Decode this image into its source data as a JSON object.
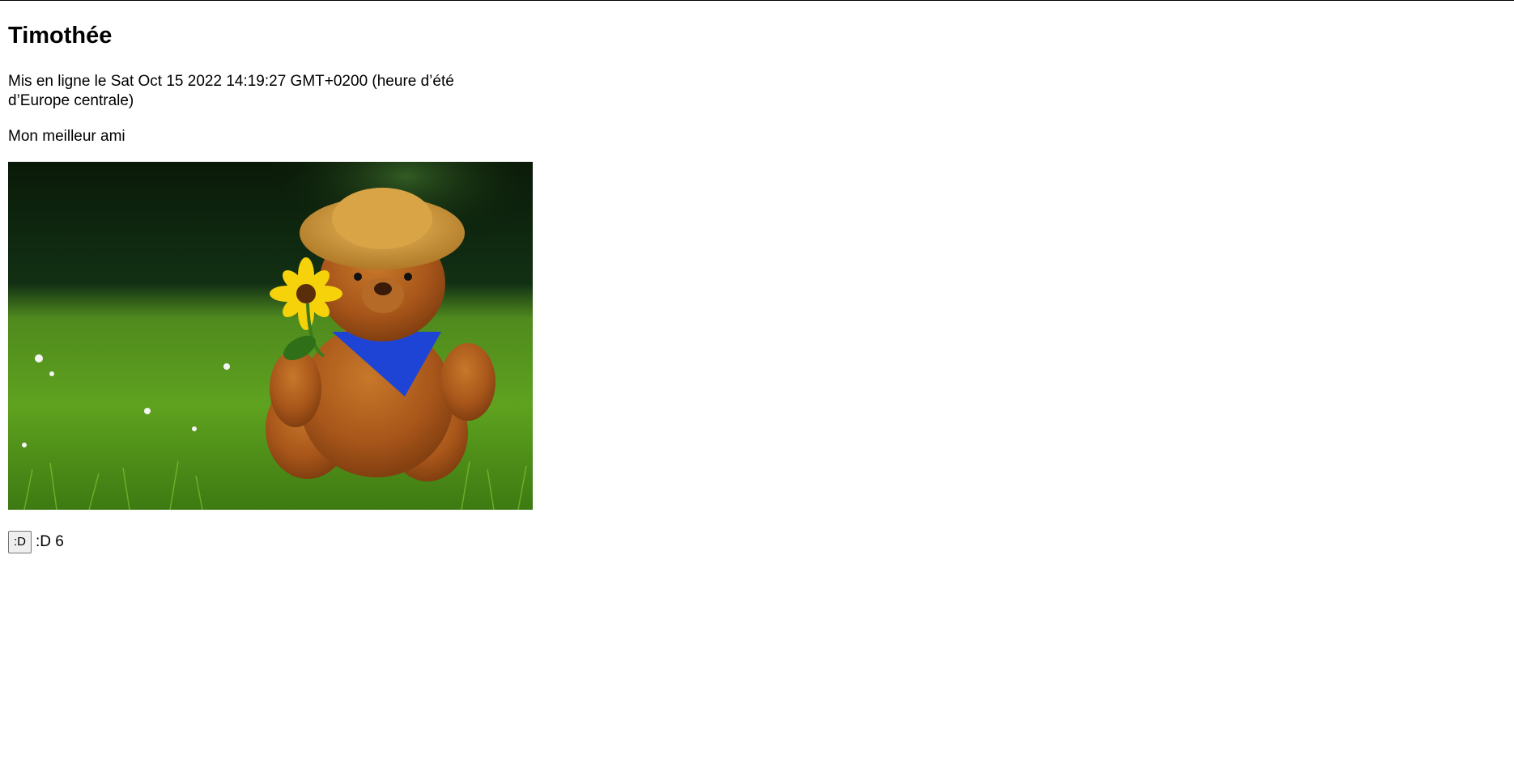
{
  "post": {
    "author": "Timothée",
    "date_line": "Mis en ligne le Sat Oct 15 2022 14:19:27 GMT+0200 (heure d’été d’Europe centrale)",
    "caption": "Mon meilleur ami",
    "image_icon": "teddy-bear-photo",
    "reaction": {
      "button_label": ":D",
      "count_label": ":D 6"
    }
  }
}
